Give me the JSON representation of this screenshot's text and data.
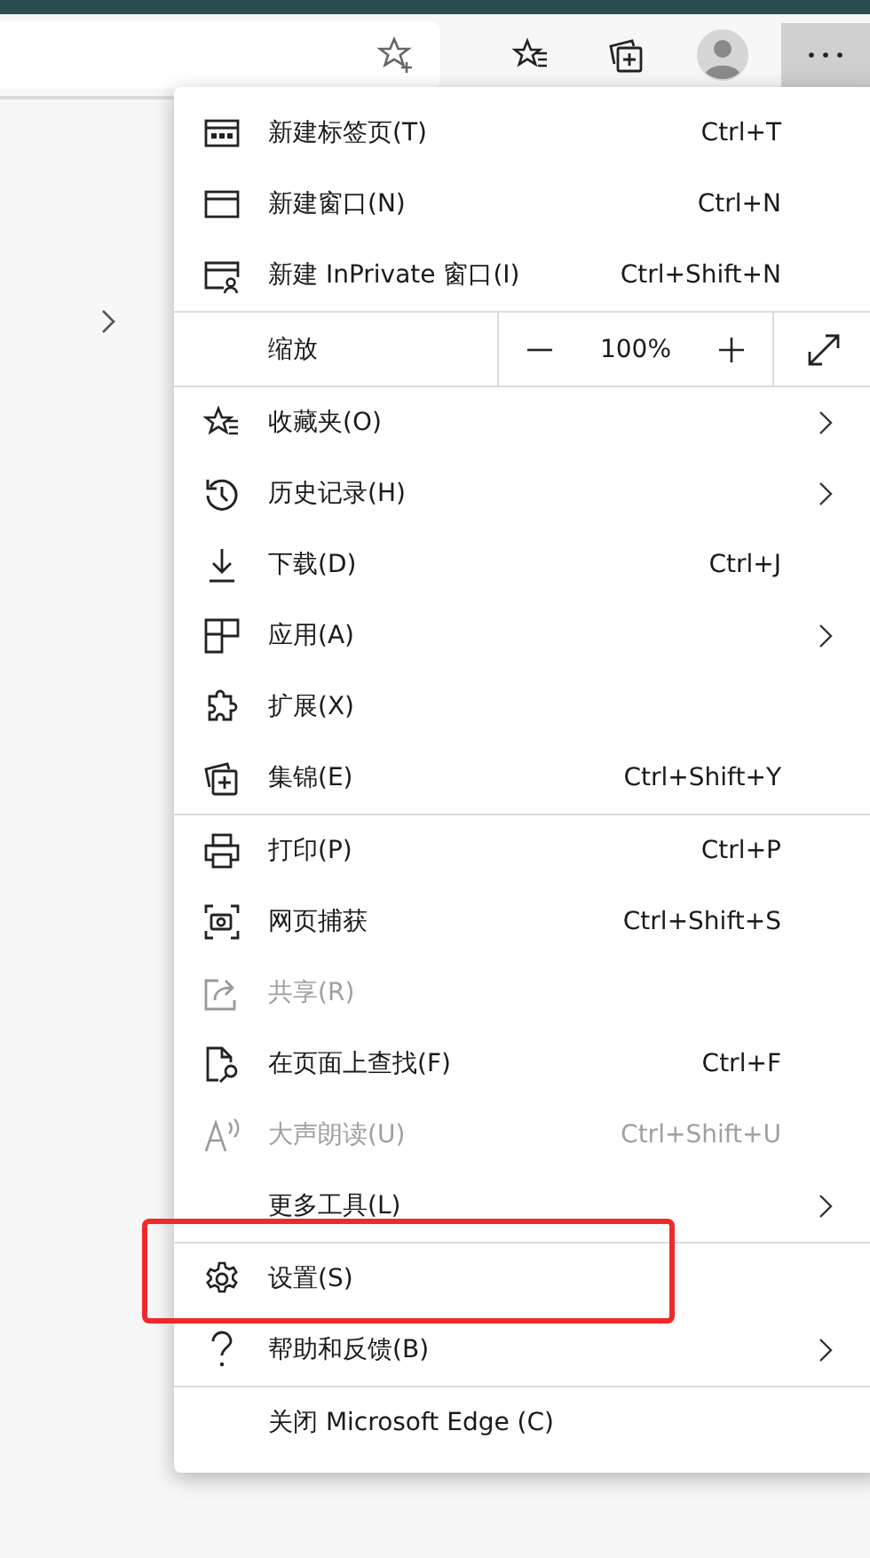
{
  "menu": {
    "sections": [
      {
        "items": [
          {
            "kind": "item",
            "label": "新建标签页(T)",
            "shortcut": "Ctrl+T",
            "submenu": false,
            "disabled": false,
            "highlighted": false
          },
          {
            "kind": "item",
            "label": "新建窗口(N)",
            "shortcut": "Ctrl+N",
            "submenu": false,
            "disabled": false,
            "highlighted": false
          },
          {
            "kind": "item",
            "label": "新建 InPrivate 窗口(I)",
            "shortcut": "Ctrl+Shift+N",
            "submenu": false,
            "disabled": false,
            "highlighted": false
          }
        ]
      },
      {
        "items": [
          {
            "kind": "zoom",
            "label": "缩放",
            "value": "100%"
          }
        ]
      },
      {
        "items": [
          {
            "kind": "item",
            "label": "收藏夹(O)",
            "submenu": true,
            "disabled": false,
            "highlighted": false
          },
          {
            "kind": "item",
            "label": "历史记录(H)",
            "submenu": true,
            "disabled": false,
            "highlighted": false
          },
          {
            "kind": "item",
            "label": "下载(D)",
            "shortcut": "Ctrl+J",
            "submenu": false,
            "disabled": false,
            "highlighted": false
          },
          {
            "kind": "item",
            "label": "应用(A)",
            "submenu": true,
            "disabled": false,
            "highlighted": false
          },
          {
            "kind": "item",
            "label": "扩展(X)",
            "submenu": false,
            "disabled": false,
            "highlighted": false
          },
          {
            "kind": "item",
            "label": "集锦(E)",
            "shortcut": "Ctrl+Shift+Y",
            "submenu": false,
            "disabled": false,
            "highlighted": false
          }
        ]
      },
      {
        "items": [
          {
            "kind": "item",
            "label": "打印(P)",
            "shortcut": "Ctrl+P",
            "submenu": false,
            "disabled": false,
            "highlighted": false
          },
          {
            "kind": "item",
            "label": "网页捕获",
            "shortcut": "Ctrl+Shift+S",
            "submenu": false,
            "disabled": false,
            "highlighted": false
          },
          {
            "kind": "item",
            "label": "共享(R)",
            "submenu": false,
            "disabled": true,
            "highlighted": false
          },
          {
            "kind": "item",
            "label": "在页面上查找(F)",
            "shortcut": "Ctrl+F",
            "submenu": false,
            "disabled": false,
            "highlighted": false
          },
          {
            "kind": "item",
            "label": "大声朗读(U)",
            "shortcut": "Ctrl+Shift+U",
            "submenu": false,
            "disabled": true,
            "highlighted": false
          },
          {
            "kind": "item",
            "label": "更多工具(L)",
            "submenu": true,
            "disabled": false,
            "highlighted": false
          }
        ]
      },
      {
        "items": [
          {
            "kind": "item",
            "label": "设置(S)",
            "submenu": false,
            "disabled": false,
            "highlighted": true
          },
          {
            "kind": "item",
            "label": "帮助和反馈(B)",
            "submenu": true,
            "disabled": false,
            "highlighted": false
          }
        ]
      },
      {
        "items": [
          {
            "kind": "item",
            "label": "关闭 Microsoft Edge (C)",
            "submenu": false,
            "disabled": false,
            "highlighted": false
          }
        ]
      }
    ]
  }
}
